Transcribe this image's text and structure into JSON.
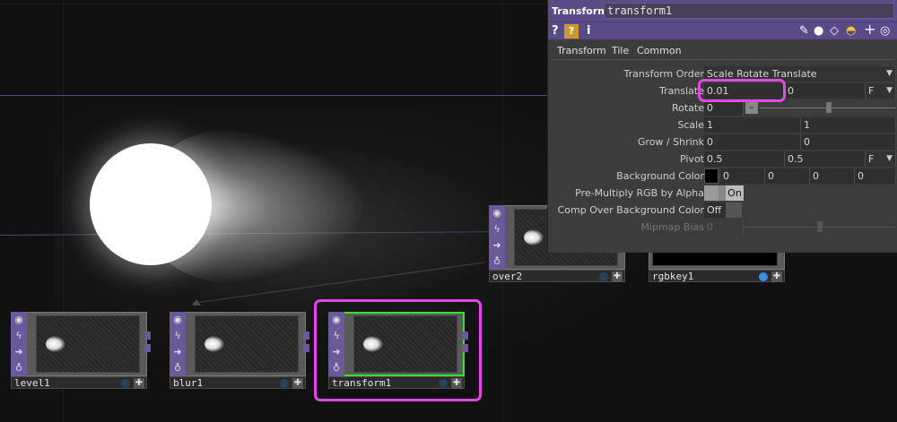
{
  "nodes": [
    {
      "name": "level1",
      "viewer_on": false,
      "selected": false
    },
    {
      "name": "blur1",
      "viewer_on": false,
      "selected": false
    },
    {
      "name": "transform1",
      "viewer_on": false,
      "selected": true
    },
    {
      "name": "over2",
      "viewer_on": false,
      "selected": false
    },
    {
      "name": "rgbkey1",
      "viewer_on": true,
      "selected": false
    }
  ],
  "node_strip_icons": [
    "viewer-icon",
    "bypass-icon",
    "forward-icon",
    "lock-icon"
  ],
  "panel": {
    "op_type": "Transform",
    "op_name": "transform1",
    "toolbar_left": [
      "?",
      "i"
    ],
    "toolbar_right_icons": [
      "pencil-icon",
      "comment-icon",
      "eraser-icon",
      "python-icon",
      "plus-icon",
      "target-icon"
    ],
    "tabs": [
      "Transform",
      "Tile",
      "Common"
    ],
    "active_tab": "Transform",
    "params": {
      "transform_order": {
        "label": "Transform Order",
        "value": "Scale Rotate Translate"
      },
      "translate": {
        "label": "Translate",
        "x": "0.01",
        "y": "0",
        "unit": "F"
      },
      "rotate": {
        "label": "Rotate",
        "value": "0"
      },
      "scale": {
        "label": "Scale",
        "x": "1",
        "y": "1"
      },
      "grow_shrink": {
        "label": "Grow / Shrink",
        "x": "0",
        "y": "0"
      },
      "pivot": {
        "label": "Pivot",
        "x": "0.5",
        "y": "0.5",
        "unit": "F"
      },
      "background_color": {
        "label": "Background Color",
        "r": "0",
        "g": "0",
        "b": "0",
        "a": "0",
        "swatch": "#000000"
      },
      "premultiply": {
        "label": "Pre-Multiply RGB by Alpha",
        "value": "On"
      },
      "comp_over": {
        "label": "Comp Over Background Color",
        "value": "Off"
      },
      "mipmap_bias": {
        "label": "Mipmap Bias",
        "value": "0"
      }
    }
  },
  "colors": {
    "accent": "#5a4a88",
    "highlight": "#e14ae1",
    "selected": "#38e038"
  }
}
